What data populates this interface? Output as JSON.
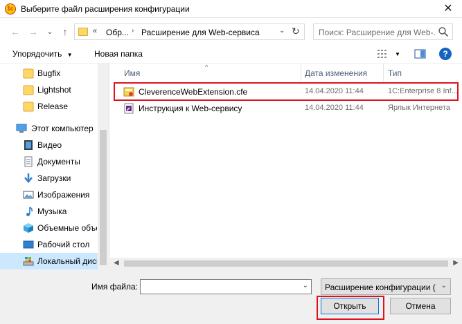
{
  "window": {
    "app_icon_text": "1c",
    "title": "Выберите файл расширения конфигурации",
    "close_glyph": "✕"
  },
  "nav": {
    "back_glyph": "←",
    "forward_glyph": "→",
    "recent_glyph": "⌄",
    "up_glyph": "↑",
    "address": {
      "overflow": "«",
      "segment1": "Обр...",
      "separator": "›",
      "segment2": "Расширение для Web-сервиса",
      "dropdown_glyph": "⌄",
      "refresh_glyph": "↻"
    },
    "search_placeholder": "Поиск: Расширение для Web-..."
  },
  "toolbar": {
    "organize_label": "Упорядочить",
    "organize_arrow": "▼",
    "new_folder_label": "Новая папка",
    "view_arrow": "▼",
    "help_glyph": "?"
  },
  "sidebar": {
    "items": [
      {
        "label": "Bugfix",
        "icon": "folder-icon"
      },
      {
        "label": "Lightshot",
        "icon": "folder-icon"
      },
      {
        "label": "Release",
        "icon": "folder-icon"
      },
      {
        "label": "Этот компьютер",
        "icon": "computer-icon"
      },
      {
        "label": "Видео",
        "icon": "video-icon"
      },
      {
        "label": "Документы",
        "icon": "documents-icon"
      },
      {
        "label": "Загрузки",
        "icon": "downloads-icon"
      },
      {
        "label": "Изображения",
        "icon": "pictures-icon"
      },
      {
        "label": "Музыка",
        "icon": "music-icon"
      },
      {
        "label": "Объемные объекты",
        "icon": "3d-objects-icon"
      },
      {
        "label": "Рабочий стол",
        "icon": "desktop-icon"
      },
      {
        "label": "Локальный диск (C:)",
        "icon": "drive-icon",
        "selected": true
      }
    ]
  },
  "files": {
    "columns": {
      "name": "Имя",
      "date": "Дата изменения",
      "type": "Тип"
    },
    "sort_arrow": "^",
    "rows": [
      {
        "name": "CleverenceWebExtension.cfe",
        "date": "14.04.2020 11:44",
        "type": "1C:Enterprise 8 Inf...",
        "icon": "cfe-file-icon"
      },
      {
        "name": "Инструкция к Web-сервису",
        "date": "14.04.2020 11:44",
        "type": "Ярлык Интернета",
        "icon": "internet-shortcut-icon"
      }
    ]
  },
  "hscroll": {
    "left_glyph": "◀",
    "right_glyph": "▶"
  },
  "bottom": {
    "filename_label": "Имя файла:",
    "filename_value": "",
    "filename_drop": "⌄",
    "filetype_value": "Расширение конфигурации (*.cfe)",
    "filetype_drop": "⌄",
    "open_label": "Открыть",
    "cancel_label": "Отмена"
  },
  "colors": {
    "highlight": "#e0101e",
    "selected_bg": "#cce8ff",
    "header_text": "#4c607a"
  }
}
